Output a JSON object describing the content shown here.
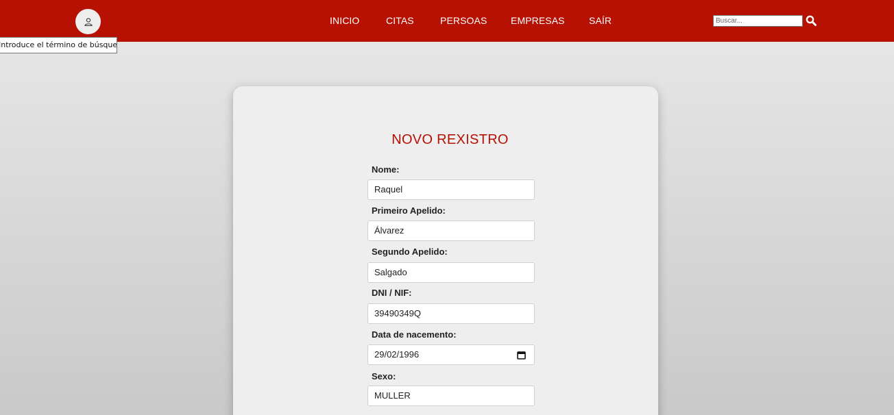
{
  "nav": {
    "links": [
      "INICIO",
      "CITAS",
      "PERSOAS",
      "EMPRESAS",
      "SAÍR"
    ],
    "search_placeholder": "Buscar...",
    "tooltip": "Introduce el término de búsqueda",
    "icons": {
      "avatar": "user-icon",
      "search": "search-icon"
    },
    "colors": {
      "bar": "#b71104",
      "text": "#ffffff"
    }
  },
  "form": {
    "title": "NOVO REXISTRO",
    "fields": [
      {
        "label": "Nome:",
        "value": "Raquel"
      },
      {
        "label": "Primeiro Apelido:",
        "value": "Álvarez"
      },
      {
        "label": "Segundo Apelido:",
        "value": "Salgado"
      },
      {
        "label": "DNI / NIF:",
        "value": "39490349Q"
      },
      {
        "label": "Data de nacemento:",
        "value": "29/02/1996",
        "icon": "calendar-icon"
      },
      {
        "label": "Sexo:",
        "value": "MULLER"
      }
    ],
    "colors": {
      "title": "#b71104"
    }
  }
}
